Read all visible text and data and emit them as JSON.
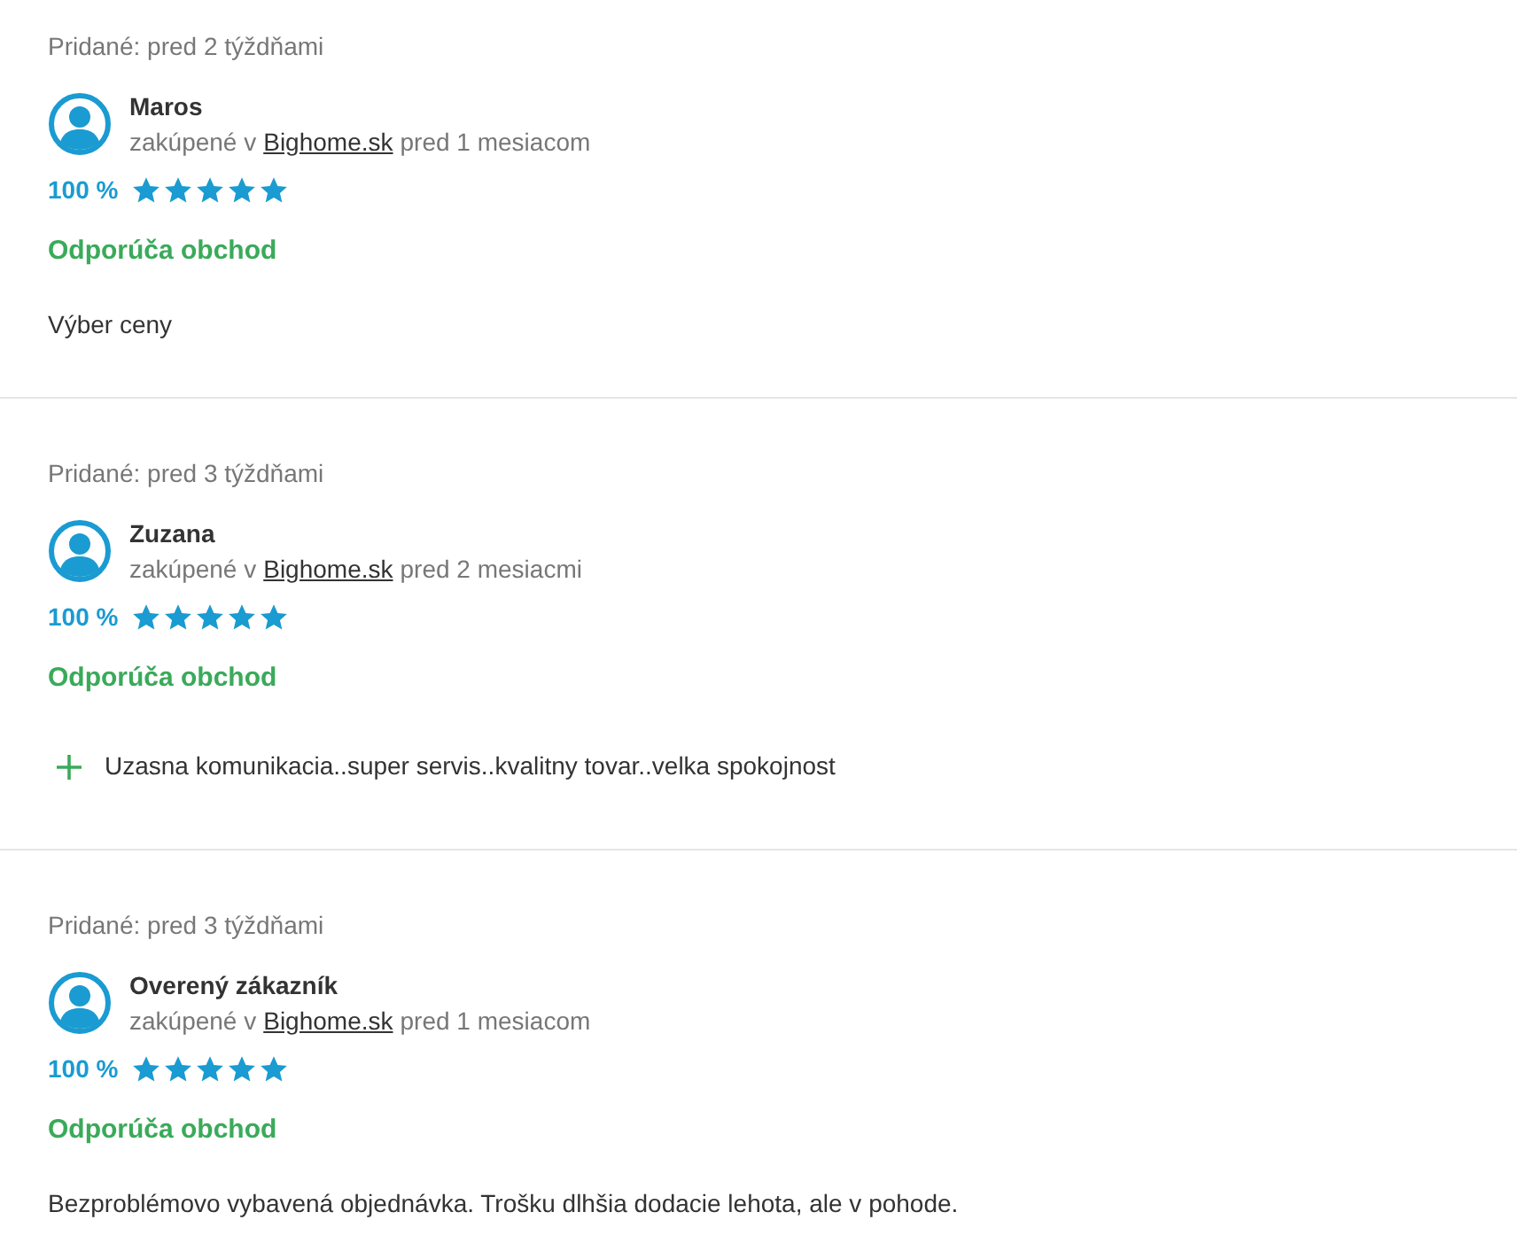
{
  "reviews": [
    {
      "added": "Pridané: pred 2 týždňami",
      "name": "Maros",
      "purchase_prefix": "zakúpené v",
      "shop_link": "Bighome.sk",
      "purchase_suffix": "pred 1 mesiacom",
      "percent": "100 %",
      "stars": 5,
      "recommend": "Odporúča obchod",
      "comment": {
        "kind": "plain",
        "text": "Výber ceny"
      }
    },
    {
      "added": "Pridané: pred 3 týždňami",
      "name": "Zuzana",
      "purchase_prefix": "zakúpené v",
      "shop_link": "Bighome.sk",
      "purchase_suffix": "pred 2 mesiacmi",
      "percent": "100 %",
      "stars": 5,
      "recommend": "Odporúča obchod",
      "comment": {
        "kind": "pro",
        "text": "Uzasna komunikacia..super servis..kvalitny tovar..velka spokojnost"
      }
    },
    {
      "added": "Pridané: pred 3 týždňami",
      "name": "Overený zákazník",
      "purchase_prefix": "zakúpené v",
      "shop_link": "Bighome.sk",
      "purchase_suffix": "pred 1 mesiacom",
      "percent": "100 %",
      "stars": 5,
      "recommend": "Odporúča obchod",
      "comment": {
        "kind": "plain",
        "text": "Bezproblémovo vybavená objednávka. Trošku dlhšia dodacie lehota, ale v pohode."
      }
    }
  ]
}
